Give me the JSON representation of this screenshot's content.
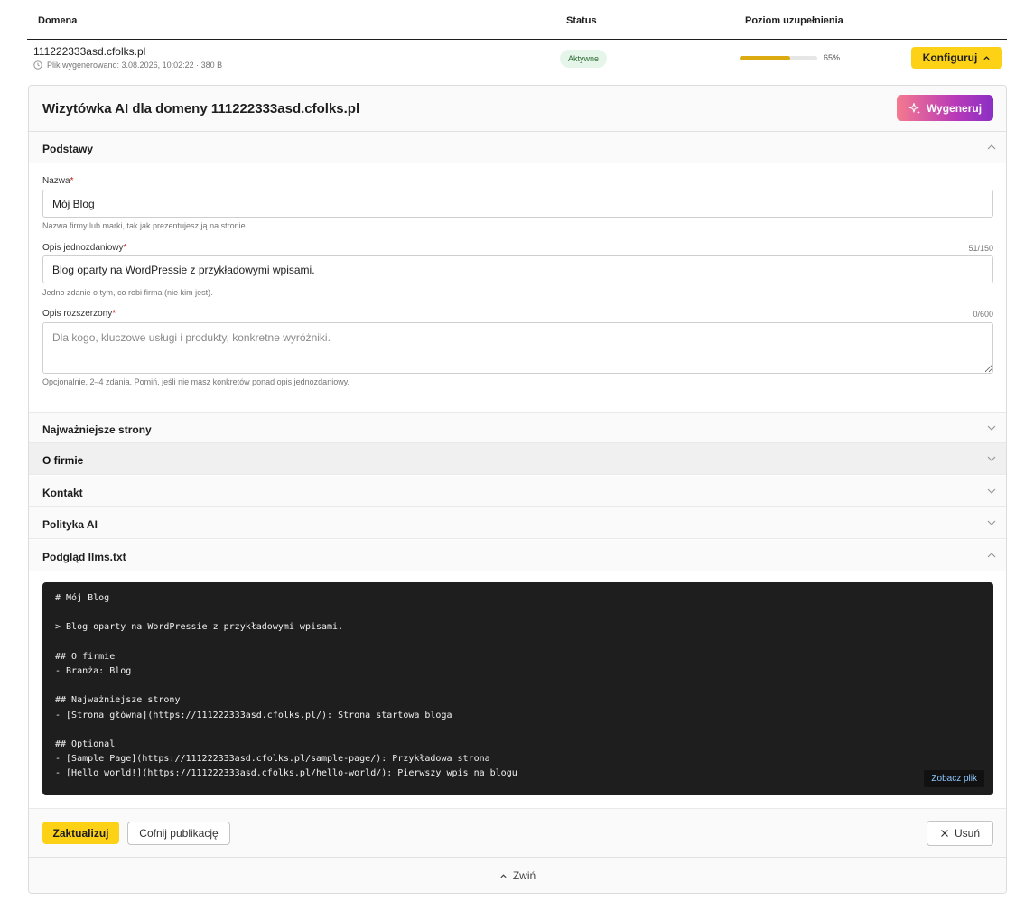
{
  "table": {
    "columns": {
      "domain": "Domena",
      "status": "Status",
      "level": "Poziom uzupełnienia"
    },
    "row": {
      "domain": "111222333asd.cfolks.pl",
      "meta": "Plik wygenerowano: 3.08.2026, 10:02:22 · 380 B",
      "status": "Aktywne",
      "progress_percent": 65,
      "progress_label": "65%",
      "configure_label": "Konfiguruj"
    }
  },
  "panel": {
    "title": "Wizytówka AI dla domeny 111222333asd.cfolks.pl",
    "generate_label": "Wygeneruj",
    "sections": {
      "basics": "Podstawy",
      "pages": "Najważniejsze strony",
      "about": "O firmie",
      "contact": "Kontakt",
      "policy": "Polityka AI",
      "preview": "Podgląd llms.txt"
    },
    "fields": {
      "name": {
        "label": "Nazwa",
        "required": "*",
        "value": "Mój Blog",
        "help": "Nazwa firmy lub marki, tak jak prezentujesz ją na stronie."
      },
      "short_desc": {
        "label": "Opis jednozdaniowy",
        "required": "*",
        "counter": "51/150",
        "value": "Blog oparty na WordPressie z przykładowymi wpisami.",
        "help": "Jedno zdanie o tym, co robi firma (nie kim jest)."
      },
      "long_desc": {
        "label": "Opis rozszerzony",
        "required": "*",
        "counter": "0/600",
        "placeholder": "Dla kogo, kluczowe usługi i produkty, konkretne wyróżniki.",
        "help": "Opcjonalnie, 2–4 zdania. Pomiń, jeśli nie masz konkretów ponad opis jednozdaniowy."
      }
    },
    "preview_lines": [
      "# Mój Blog",
      "",
      "> Blog oparty na WordPressie z przykładowymi wpisami.",
      "",
      "## O firmie",
      "- Branża: Blog",
      "",
      "## Najważniejsze strony",
      "- [Strona główna](https://111222333asd.cfolks.pl/): Strona startowa bloga",
      "",
      "## Optional",
      "- [Sample Page](https://111222333asd.cfolks.pl/sample-page/): Przykładowa strona",
      "- [Hello world!](https://111222333asd.cfolks.pl/hello-world/): Pierwszy wpis na blogu"
    ],
    "view_file_label": "Zobacz plik",
    "actions": {
      "update": "Zaktualizuj",
      "unpublish": "Cofnij publikację",
      "delete": "Usuń"
    },
    "collapse_label": "Zwiń"
  },
  "colors": {
    "accent_yellow": "#fcd116",
    "progress_fill": "#dcab12",
    "status_bg": "#e6f5e9",
    "code_bg": "#1e1e1e"
  },
  "icons": [
    "clock-icon",
    "chevron-up-icon",
    "sparkle-icon",
    "chevron-down-icon",
    "close-icon"
  ]
}
